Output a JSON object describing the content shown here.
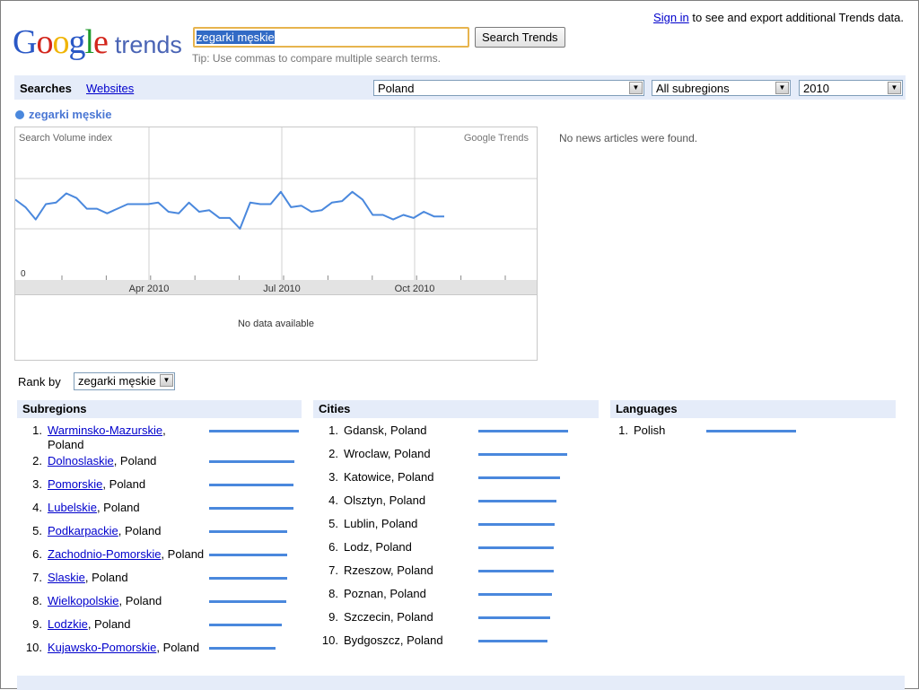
{
  "header": {
    "logo_parts": [
      "G",
      "o",
      "o",
      "g",
      "l",
      "e"
    ],
    "logo_trends": "trends",
    "search_value": "zegarki męskie",
    "search_button": "Search Trends",
    "tip": "Tip: Use commas to compare multiple search terms.",
    "sign_in": "Sign in",
    "sign_in_rest": " to see and export additional Trends data."
  },
  "nav": {
    "searches": "Searches",
    "websites": "Websites",
    "country": "Poland",
    "subregion": "All subregions",
    "year": "2010"
  },
  "legend_term": "zegarki męskie",
  "chart_data": {
    "type": "line",
    "ylabel": "Search Volume index",
    "watermark": "Google Trends",
    "y_tick": "0",
    "x_ticks": [
      "Apr 2010",
      "Jul 2010",
      "Oct 2010"
    ],
    "values": [
      0.53,
      0.48,
      0.4,
      0.5,
      0.51,
      0.57,
      0.54,
      0.47,
      0.47,
      0.44,
      0.47,
      0.5,
      0.5,
      0.5,
      0.51,
      0.45,
      0.44,
      0.51,
      0.45,
      0.46,
      0.41,
      0.41,
      0.34,
      0.51,
      0.5,
      0.5,
      0.58,
      0.48,
      0.49,
      0.45,
      0.46,
      0.51,
      0.52,
      0.58,
      0.53,
      0.43,
      0.43,
      0.4,
      0.43,
      0.41,
      0.45,
      0.42,
      0.42
    ],
    "series_color": "#4a88dd"
  },
  "no_data": "No data available",
  "news": "No news articles were found.",
  "rank_by_label": "Rank by",
  "rank_by_value": "zegarki męskie",
  "subregions": {
    "title": "Subregions",
    "items": [
      {
        "rank": "1.",
        "name": "Warminsko-Mazurskie",
        "suffix": ",",
        "second_line": "Poland",
        "bar": 1.0
      },
      {
        "rank": "2.",
        "name": "Dolnoslaskie",
        "suffix": ", Poland",
        "bar": 0.95
      },
      {
        "rank": "3.",
        "name": "Pomorskie",
        "suffix": ", Poland",
        "bar": 0.94
      },
      {
        "rank": "4.",
        "name": "Lubelskie",
        "suffix": ", Poland",
        "bar": 0.94
      },
      {
        "rank": "5.",
        "name": "Podkarpackie",
        "suffix": ", Poland",
        "bar": 0.87
      },
      {
        "rank": "6.",
        "name": "Zachodnio-Pomorskie",
        "suffix": ", Poland",
        "bar": 0.87
      },
      {
        "rank": "7.",
        "name": "Slaskie",
        "suffix": ", Poland",
        "bar": 0.87
      },
      {
        "rank": "8.",
        "name": "Wielkopolskie",
        "suffix": ", Poland",
        "bar": 0.86
      },
      {
        "rank": "9.",
        "name": "Lodzkie",
        "suffix": ", Poland",
        "bar": 0.81
      },
      {
        "rank": "10.",
        "name": "Kujawsko-Pomorskie",
        "suffix": ", Poland",
        "bar": 0.74
      }
    ]
  },
  "cities": {
    "title": "Cities",
    "items": [
      {
        "rank": "1.",
        "name": "Gdansk, Poland",
        "bar": 1.0
      },
      {
        "rank": "2.",
        "name": "Wroclaw, Poland",
        "bar": 0.99
      },
      {
        "rank": "3.",
        "name": "Katowice, Poland",
        "bar": 0.91
      },
      {
        "rank": "4.",
        "name": "Olsztyn, Poland",
        "bar": 0.87
      },
      {
        "rank": "5.",
        "name": "Lublin, Poland",
        "bar": 0.85
      },
      {
        "rank": "6.",
        "name": "Lodz, Poland",
        "bar": 0.84
      },
      {
        "rank": "7.",
        "name": "Rzeszow, Poland",
        "bar": 0.84
      },
      {
        "rank": "8.",
        "name": "Poznan, Poland",
        "bar": 0.82
      },
      {
        "rank": "9.",
        "name": "Szczecin, Poland",
        "bar": 0.8
      },
      {
        "rank": "10.",
        "name": "Bydgoszcz, Poland",
        "bar": 0.77
      }
    ]
  },
  "languages": {
    "title": "Languages",
    "items": [
      {
        "rank": "1.",
        "name": "Polish",
        "bar": 1.0
      }
    ]
  }
}
